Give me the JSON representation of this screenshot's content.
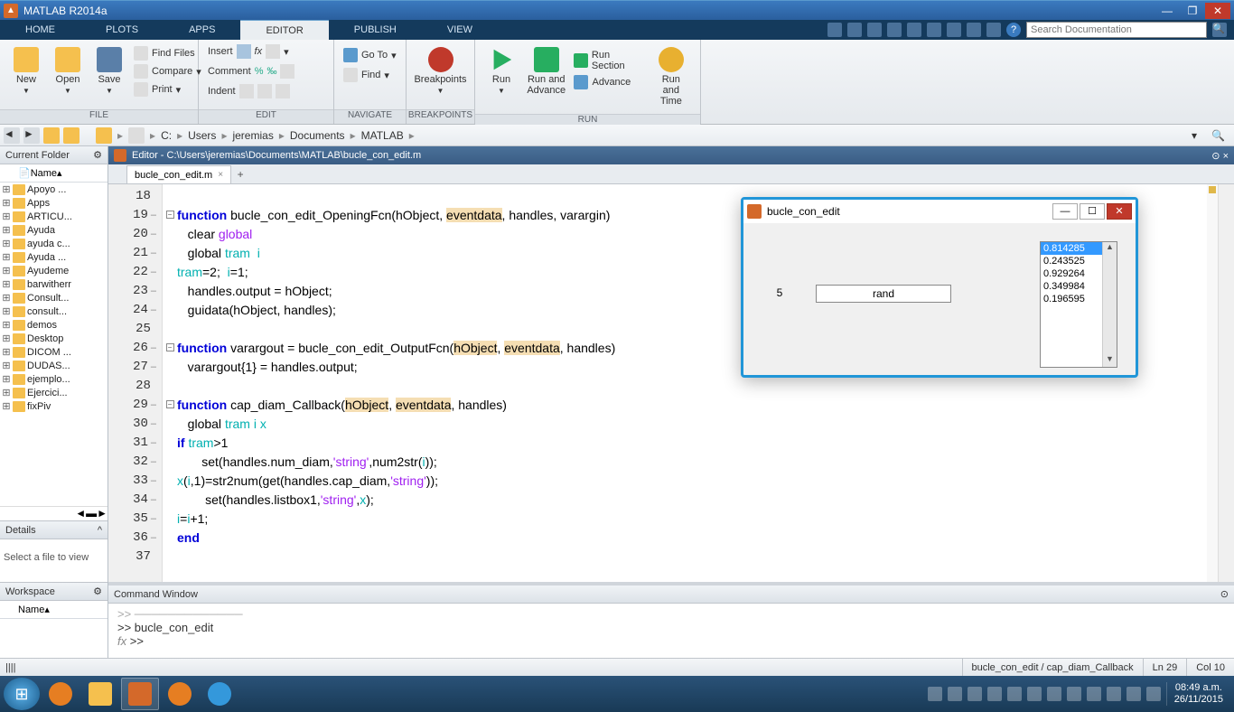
{
  "app": {
    "title": "MATLAB R2014a"
  },
  "win_buttons": {
    "min": "—",
    "max": "❐",
    "close": "✕"
  },
  "tabs": {
    "home": "HOME",
    "plots": "PLOTS",
    "apps": "APPS",
    "editor": "EDITOR",
    "publish": "PUBLISH",
    "view": "VIEW"
  },
  "search": {
    "placeholder": "Search Documentation"
  },
  "ribbon": {
    "file": {
      "label": "FILE",
      "new": "New",
      "open": "Open",
      "save": "Save",
      "findfiles": "Find Files",
      "compare": "Compare",
      "print": "Print"
    },
    "edit": {
      "label": "EDIT",
      "comment": "Comment",
      "insert": "Insert",
      "indent": "Indent"
    },
    "navigate": {
      "label": "NAVIGATE",
      "goto": "Go To",
      "find": "Find"
    },
    "breakpoints": {
      "label": "BREAKPOINTS",
      "btn": "Breakpoints"
    },
    "run": {
      "label": "RUN",
      "run": "Run",
      "runadv": "Run and\nAdvance",
      "runsec": "Run Section",
      "advance": "Advance",
      "runtime": "Run and\nTime"
    }
  },
  "path": {
    "drive": "C:",
    "p1": "Users",
    "p2": "jeremias",
    "p3": "Documents",
    "p4": "MATLAB"
  },
  "leftpanels": {
    "currentfolder": "Current Folder",
    "namecol": "Name",
    "folders": [
      "Apoyo ...",
      "Apps",
      "ARTICU...",
      "Ayuda",
      "ayuda c...",
      "Ayuda ...",
      "Ayudeme",
      "barwitherr",
      "Consult...",
      "consult...",
      "demos",
      "Desktop",
      "DICOM ...",
      "DUDAS...",
      "ejemplo...",
      "Ejercici...",
      "fixPiv"
    ],
    "details": "Details",
    "detailstext": "Select a file to view",
    "workspace": "Workspace",
    "wsname": "Name"
  },
  "editor": {
    "header": "Editor - C:\\Users\\jeremias\\Documents\\MATLAB\\bucle_con_edit.m",
    "tabname": "bucle_con_edit.m",
    "lines": {
      "l18": "",
      "l19a": "function",
      "l19b": " bucle_con_edit_OpeningFcn(hObject, ",
      "l19c": "eventdata",
      "l19d": ", handles, varargin)",
      "l20a": "clear ",
      "l20b": "global",
      "l21a": "global ",
      "l21b": "tram  i",
      "l22a": "tram",
      "l22b": "=2;  ",
      "l22c": "i",
      "l22d": "=1;",
      "l23": "handles.output = hObject;",
      "l24": "guidata(hObject, handles);",
      "l25": "",
      "l26a": "function",
      "l26b": " varargout = bucle_con_edit_OutputFcn(",
      "l26c": "hObject",
      "l26d": ", ",
      "l26e": "eventdata",
      "l26f": ", handles)",
      "l27": "varargout{1} = handles.output;",
      "l28": "",
      "l29a": "function",
      "l29b": " cap_diam_Callback(",
      "l29c": "hObject",
      "l29d": ", ",
      "l29e": "eventdata",
      "l29f": ", handles)",
      "l30a": "global ",
      "l30b": "tram i x",
      "l31a": "if ",
      "l31b": "tram",
      "l31c": ">1",
      "l32a": "    set(handles.num_diam,",
      "l32b": "'string'",
      "l32c": ",num2str(",
      "l32d": "i",
      "l32e": "));",
      "l33a": "    ",
      "l33b": "x",
      "l33c": "(",
      "l33d": "i",
      "l33e": ",1)=str2num(get(handles.cap_diam,",
      "l33f": "'string'",
      "l33g": "));",
      "l34a": "     set(handles.listbox1,",
      "l34b": "'string'",
      "l34c": ",",
      "l34d": "x",
      "l34e": ");",
      "l35a": "    ",
      "l35b": "i",
      "l35c": "=",
      "l35d": "i",
      "l35e": "+1;",
      "l36": "end",
      "l37": ""
    },
    "linenums": [
      "18",
      "19",
      "20",
      "21",
      "22",
      "23",
      "24",
      "25",
      "26",
      "27",
      "28",
      "29",
      "30",
      "31",
      "32",
      "33",
      "34",
      "35",
      "36",
      "37"
    ]
  },
  "figure": {
    "title": "bucle_con_edit",
    "num": "5",
    "edit": "rand",
    "list": [
      "0.814285",
      "0.243525",
      "0.929264",
      "0.349984",
      "0.196595"
    ]
  },
  "cmdwin": {
    "title": "Command Window",
    "line1": ">> bucle_con_edit",
    "prompt": ">> ",
    "fx": "fx"
  },
  "status": {
    "func": "bucle_con_edit / cap_diam_Callback",
    "ln": "Ln  29",
    "col": "Col  10"
  },
  "clock": {
    "time": "08:49 a.m.",
    "date": "26/11/2015"
  }
}
